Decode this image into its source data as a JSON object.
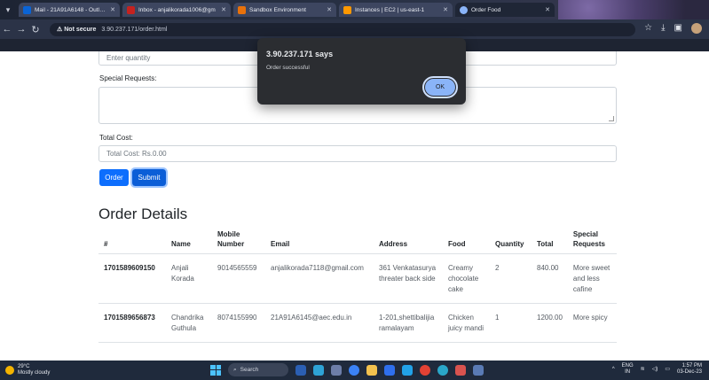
{
  "browser": {
    "tabs": [
      {
        "label": "Mail - 21A91A6148 - Outlook",
        "color": "#0a64d6"
      },
      {
        "label": "Inbox - anjalikorada1006@gm",
        "color": "#c5221f"
      },
      {
        "label": "Sandbox Environment",
        "color": "#e8710a"
      },
      {
        "label": "Instances | EC2 | us-east-1",
        "color": "#ff9900"
      },
      {
        "label": "Order Food",
        "color": "#8ab4f8"
      }
    ],
    "not_secure": "Not secure",
    "url": "3.90.237.171/order.html"
  },
  "form": {
    "quantity_placeholder": "Enter quantity",
    "special_requests_label": "Special Requests:",
    "total_cost_label": "Total Cost:",
    "total_cost_value": "Total Cost: Rs.0.00",
    "order_button": "Order",
    "submit_button": "Submit"
  },
  "orders": {
    "title": "Order Details",
    "headers": [
      "#",
      "Name",
      "Mobile Number",
      "Email",
      "Address",
      "Food",
      "Quantity",
      "Total",
      "Special Requests"
    ],
    "rows": [
      {
        "id": "1701589609150",
        "name": "Anjali Korada",
        "mobile": "9014565559",
        "email": "anjalikorada7118@gmail.com",
        "address": "361 Venkatasurya threater back side",
        "food": "Creamy chocolate cake",
        "quantity": "2",
        "total": "840.00",
        "special": "More sweet and less cafine"
      },
      {
        "id": "1701589656873",
        "name": "Chandrika Guthula",
        "mobile": "8074155990",
        "email": "21A91A6145@aec.edu.in",
        "address": "1-201,shettibalijia ramalayam",
        "food": "Chicken juicy mandi",
        "quantity": "1",
        "total": "1200.00",
        "special": "More spicy"
      }
    ]
  },
  "alert": {
    "title": "3.90.237.171 says",
    "message": "Order successful",
    "ok_label": "OK"
  },
  "taskbar": {
    "weather_temp": "29°C",
    "weather_desc": "Mostly cloudy",
    "search_placeholder": "Search",
    "lang": "ENG",
    "region": "IN",
    "time": "1:57 PM",
    "date": "03-Dec-23"
  }
}
